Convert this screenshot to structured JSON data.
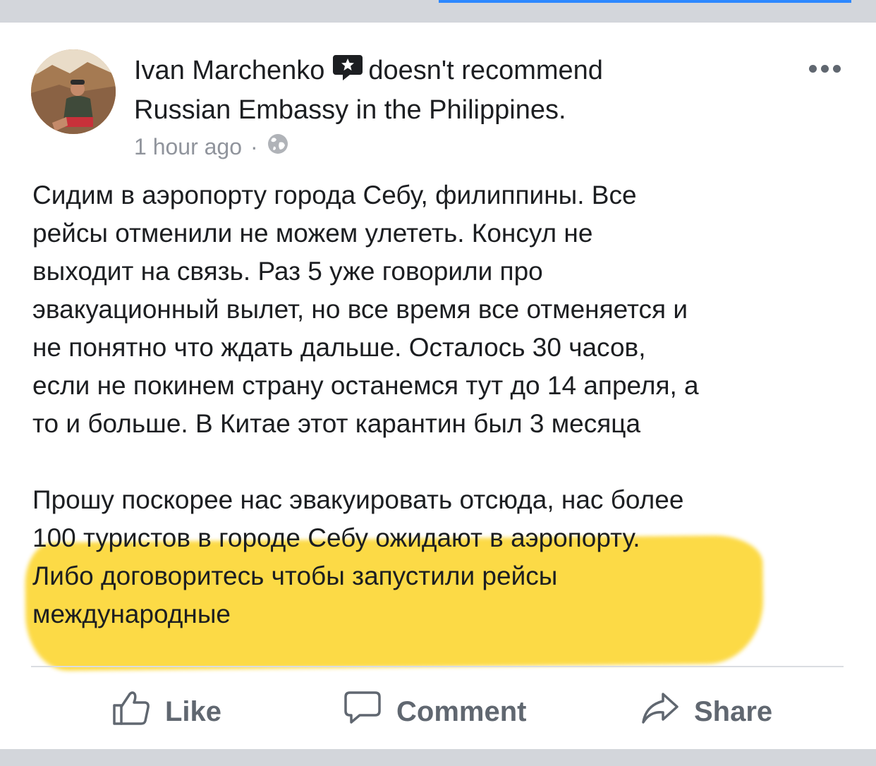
{
  "post": {
    "author": "Ivan Marchenko",
    "action_text": "doesn't recommend",
    "page_name": "Russian Embassy in the Philippines.",
    "timestamp": "1 hour ago",
    "separator": "·",
    "privacy_icon": "globe-icon",
    "paragraph_1": "Сидим в аэропорту города Себу, филиппины. Все\nрейсы отменили не можем улететь. Консул не\nвыходит на связь. Раз 5 уже говорили про\nэвакуационный вылет, но все время все отменяется и\nне понятно что ждать дальше. Осталось 30 часов,\nесли не покинем страну останемся тут до 14 апреля, а\nто и больше. В Китае этот карантин был 3 месяца",
    "paragraph_2": "Прошу поскорее нас эвакуировать отсюда, нас более\n100 туристов в городе Себу ожидают в аэропорту.\nЛибо договоритесь чтобы запустили рейсы\nмеждународные"
  },
  "actions": {
    "like_label": "Like",
    "comment_label": "Comment",
    "share_label": "Share"
  },
  "colors": {
    "accent": "#2d88ff",
    "highlight": "#fcd21e",
    "text_primary": "#1c1e21",
    "text_secondary": "#606770",
    "meta_grey": "#90949c"
  }
}
